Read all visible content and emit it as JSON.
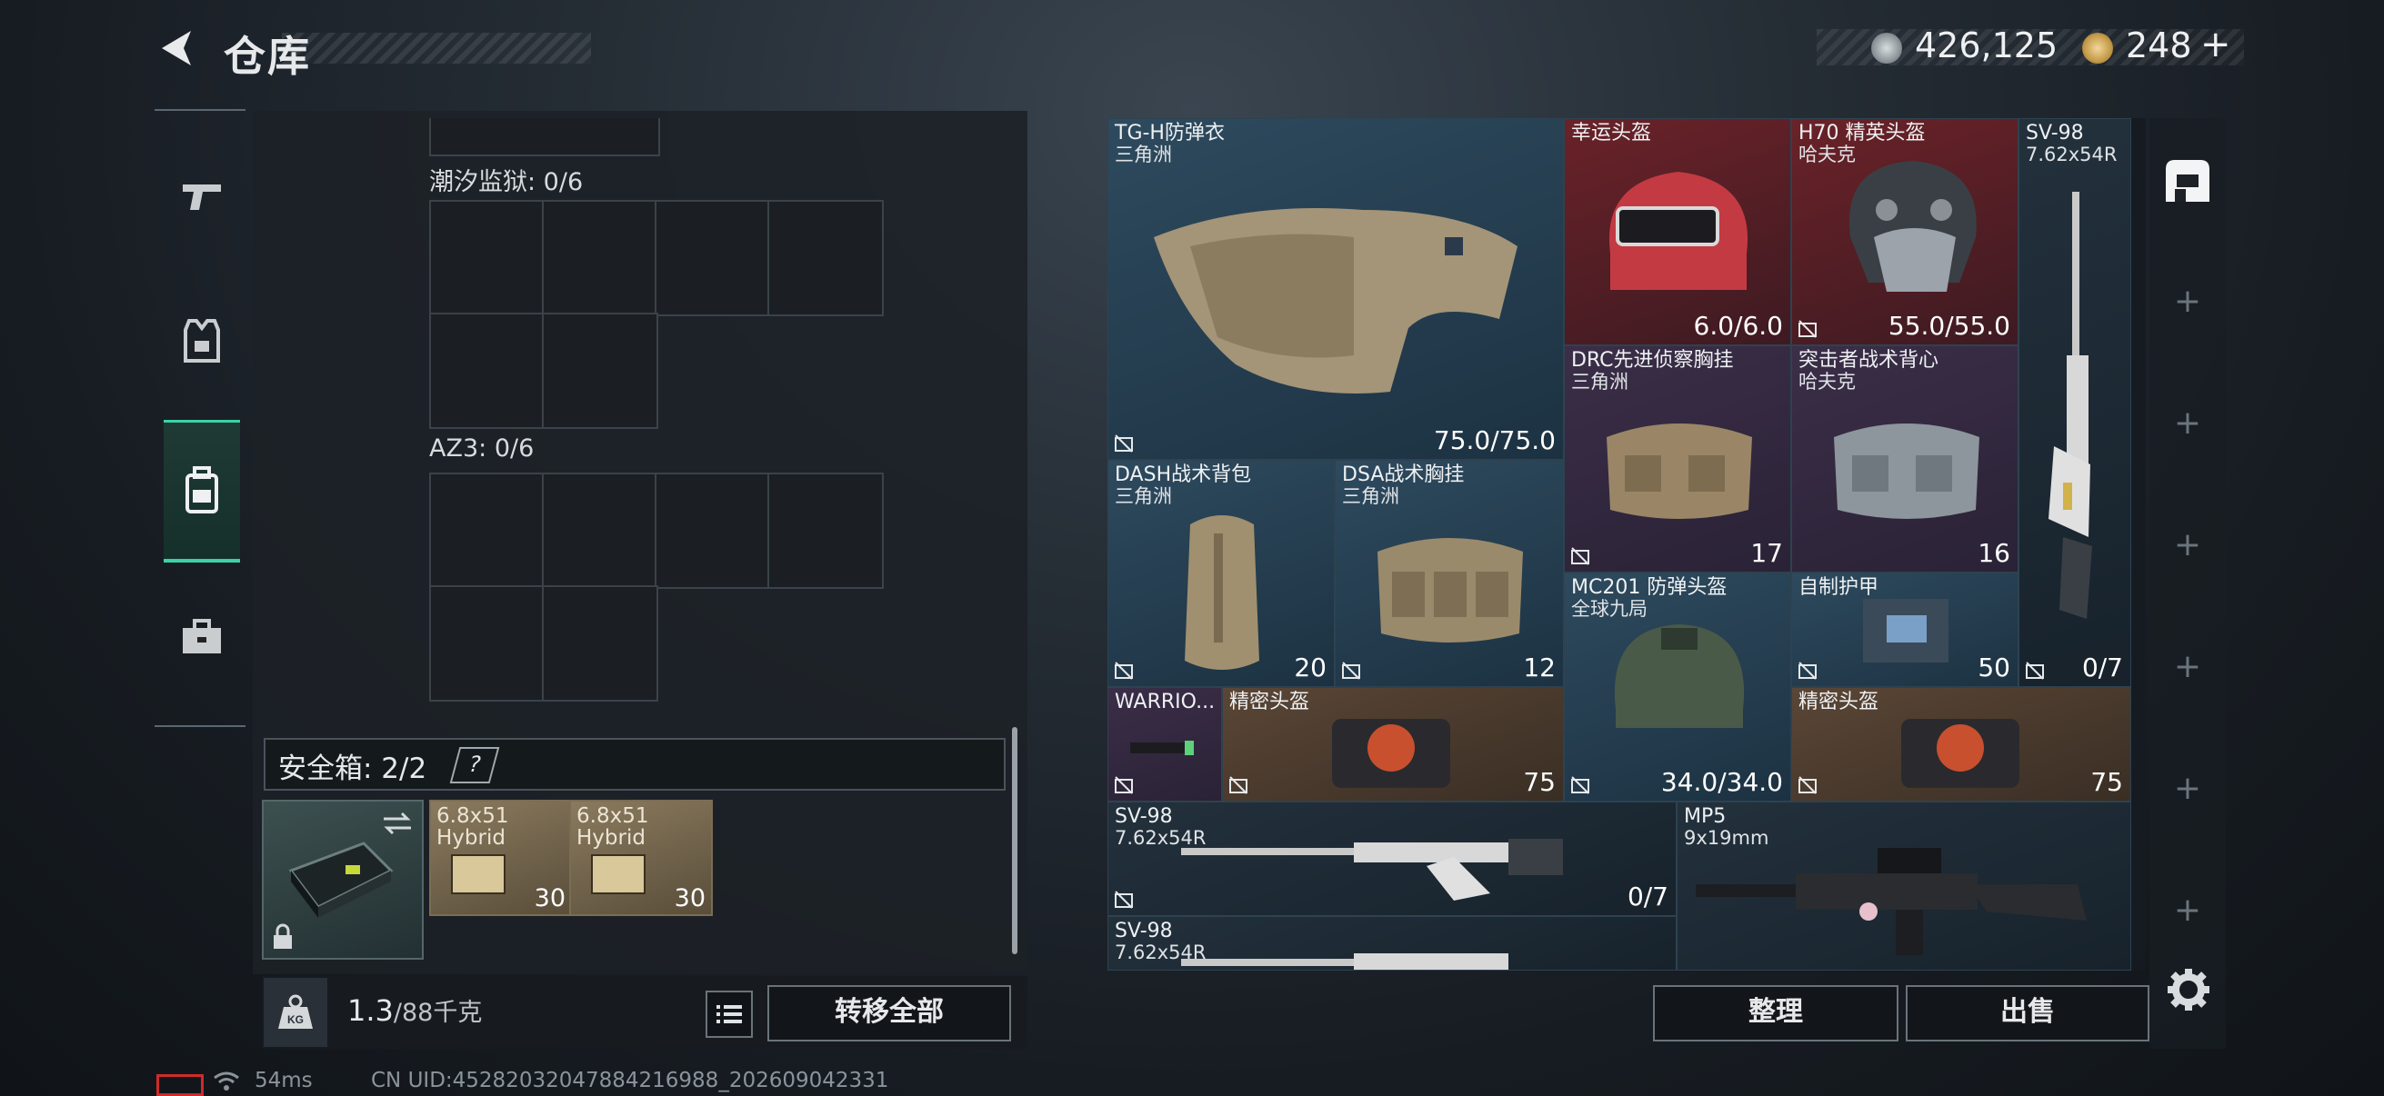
{
  "header": {
    "title": "仓库",
    "currency": [
      {
        "icon": "silver-coin-icon",
        "value": "426,125"
      },
      {
        "icon": "gold-coin-icon",
        "value": "248"
      }
    ],
    "add": "+"
  },
  "left_nav": [
    {
      "icon": "pistol-icon"
    },
    {
      "icon": "armor-vest-icon"
    },
    {
      "icon": "backpack-icon",
      "active": true
    },
    {
      "icon": "toolbox-icon"
    }
  ],
  "containers": [
    {
      "label": "潮汐监狱: 0/6"
    },
    {
      "label": "AZ3: 0/6"
    }
  ],
  "safe_box": {
    "label": "安全箱: 2/2",
    "help": "?",
    "items": [
      {
        "name": "6.8x51",
        "sub": "Hybrid",
        "count": "30"
      },
      {
        "name": "6.8x51",
        "sub": "Hybrid",
        "count": "30"
      }
    ]
  },
  "weight": {
    "current": "1.3",
    "max": "/88千克"
  },
  "actions": {
    "transfer": "转移全部",
    "sort": "整理",
    "sell": "出售"
  },
  "items": [
    {
      "name": "TG-H防弹衣",
      "sub": "三角洲",
      "value": "75.0/75.0"
    },
    {
      "name": "幸运头盔",
      "sub": "",
      "value": "6.0/6.0"
    },
    {
      "name": "H70 精英头盔",
      "sub": "哈夫克",
      "value": "55.0/55.0"
    },
    {
      "name": "SV-98",
      "sub": "7.62x54R",
      "value": "0/7"
    },
    {
      "name": "DRC先进侦察胸挂",
      "sub": "三角洲",
      "value": "17"
    },
    {
      "name": "突击者战术背心",
      "sub": "哈夫克",
      "value": "16"
    },
    {
      "name": "DASH战术背包",
      "sub": "三角洲",
      "value": "20"
    },
    {
      "name": "DSA战术胸挂",
      "sub": "三角洲",
      "value": "12"
    },
    {
      "name": "MC201 防弹头盔",
      "sub": "全球九局",
      "value": "34.0/34.0"
    },
    {
      "name": "自制护甲",
      "sub": "",
      "value": "50"
    },
    {
      "name": "WARRIO...",
      "sub": "",
      "value": ""
    },
    {
      "name": "精密头盔",
      "sub": "",
      "value": "75"
    },
    {
      "name": "精密头盔",
      "sub": "",
      "value": "75"
    },
    {
      "name": "SV-98",
      "sub": "7.62x54R",
      "value": "0/7"
    },
    {
      "name": "MP5",
      "sub": "9x19mm",
      "value": ""
    },
    {
      "name": "SV-98",
      "sub": "7.62x54R",
      "value": ""
    }
  ],
  "status_bar": {
    "ping": "54ms",
    "uid": "CN UID:4528203204788421​6988_202609042331"
  },
  "colors": {
    "accent": "#3bd2a6",
    "red_item": "#6a2228",
    "purple_item": "#3b2e48",
    "brown_item": "#5a4636",
    "blue_item": "#2e4a5e"
  }
}
